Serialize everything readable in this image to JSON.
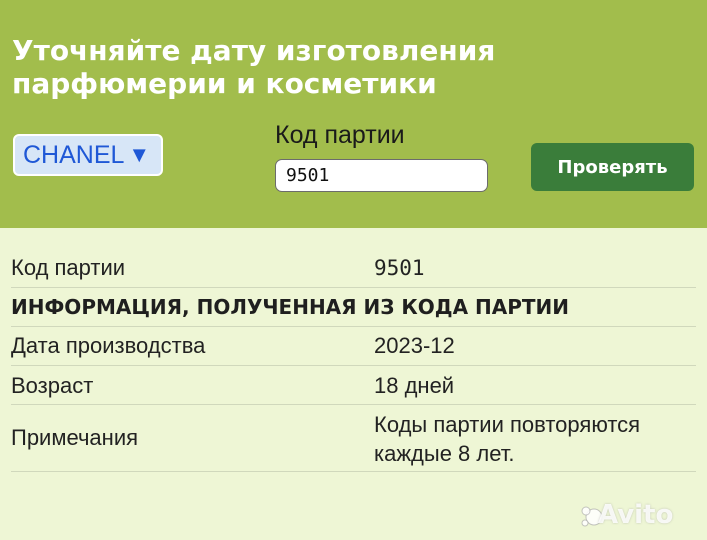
{
  "header": {
    "title": "Уточняйте дату изготовления парфюмерии и косметики",
    "brand_select": {
      "selected": "CHANEL",
      "arrow": "▼"
    },
    "batch_label": "Код партии",
    "batch_input_value": "9501",
    "check_button_label": "Проверять"
  },
  "results": {
    "batch_row": {
      "label": "Код партии",
      "value": "9501"
    },
    "section_heading": "ИНФОРМАЦИЯ, ПОЛУЧЕННАЯ ИЗ КОДА ПАРТИИ",
    "production_row": {
      "label": "Дата производства",
      "value": "2023-12"
    },
    "age_row": {
      "label": "Возраст",
      "value": "18 дней"
    },
    "notes_row": {
      "label": "Примечания",
      "value": "Коды партии повторяются каждые 8 лет."
    }
  },
  "watermark": "Avito",
  "colors": {
    "header_bg": "#a2bd4c",
    "page_bg": "#eef6d5",
    "button_bg": "#3a7d3a",
    "select_text": "#1f58d6"
  }
}
